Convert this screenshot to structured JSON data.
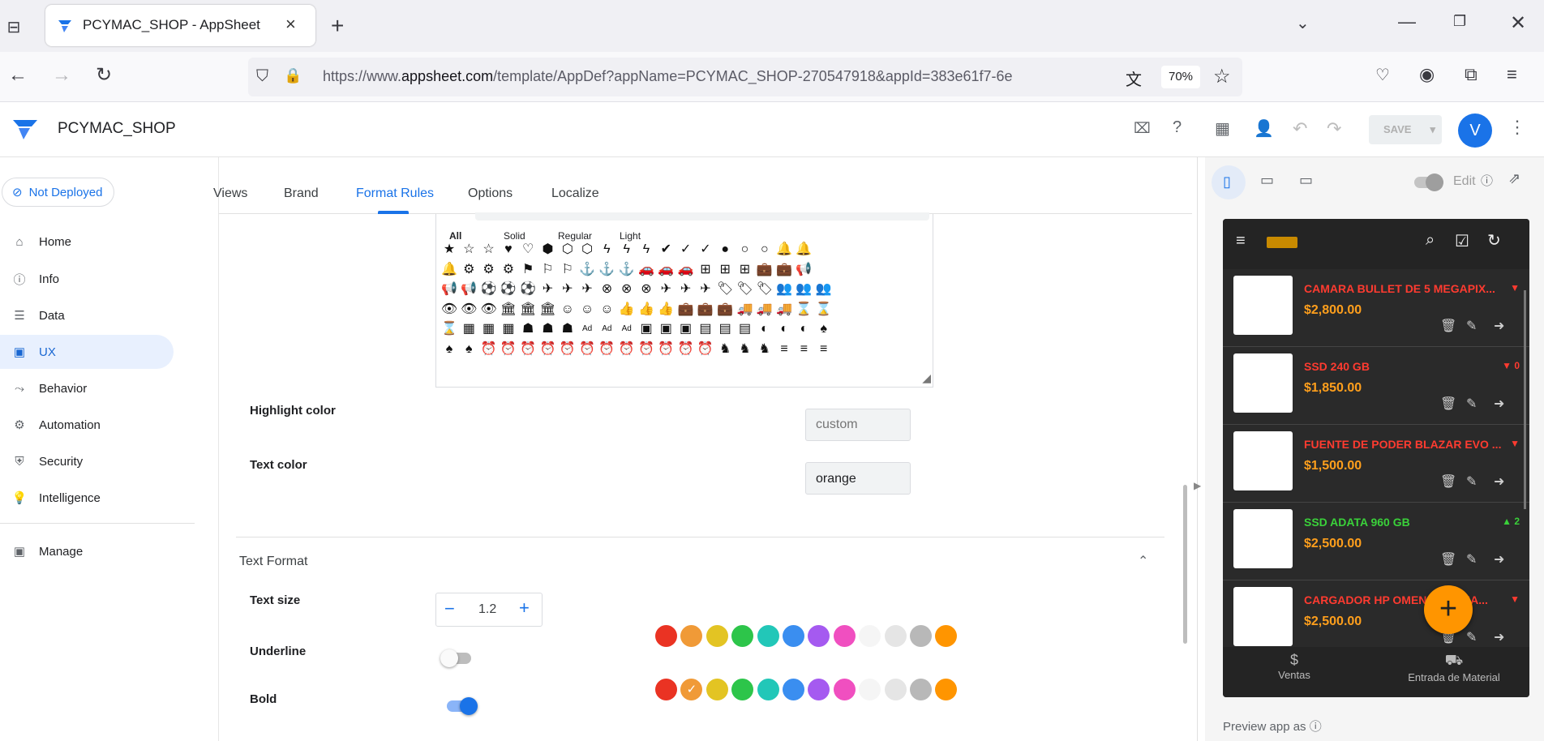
{
  "browser": {
    "tab_title": "PCYMAC_SHOP - AppSheet",
    "url_prefix": "https://www.",
    "url_domain": "appsheet.com",
    "url_rest": "/template/AppDef?appName=PCYMAC_SHOP-270547918&appId=383e61f7-6e",
    "zoom": "70%"
  },
  "app": {
    "name": "PCYMAC_SHOP",
    "save_label": "SAVE",
    "avatar_letter": "V",
    "deploy_status": "Not Deployed"
  },
  "sidebar": {
    "items": [
      {
        "label": "Home",
        "icon": "home-icon"
      },
      {
        "label": "Info",
        "icon": "info-icon"
      },
      {
        "label": "Data",
        "icon": "data-icon"
      },
      {
        "label": "UX",
        "icon": "ux-icon"
      },
      {
        "label": "Behavior",
        "icon": "behavior-icon"
      },
      {
        "label": "Automation",
        "icon": "automation-icon"
      },
      {
        "label": "Security",
        "icon": "security-icon"
      },
      {
        "label": "Intelligence",
        "icon": "intelligence-icon"
      },
      {
        "label": "Manage",
        "icon": "manage-icon"
      }
    ]
  },
  "tabs": [
    "Views",
    "Brand",
    "Format Rules",
    "Options",
    "Localize"
  ],
  "icon_picker": {
    "filters": [
      "All",
      "Solid",
      "Regular",
      "Light"
    ],
    "rows": [
      [
        "★",
        "☆",
        "☆",
        "♥",
        "♡",
        "⬢",
        "⬡",
        "⬡",
        "ϟ",
        "ϟ",
        "ϟ",
        "✔",
        "✓",
        "✓",
        "●",
        "○",
        "○",
        "🔔",
        "🔔"
      ],
      [
        "🔔",
        "⚙",
        "⚙",
        "⚙",
        "⚑",
        "⚐",
        "⚐",
        "⚓",
        "⚓",
        "⚓",
        "🚗",
        "🚗",
        "🚗",
        "⊞",
        "⊞",
        "⊞",
        "💼",
        "💼",
        "📢"
      ],
      [
        "📢",
        "📢",
        "⚽",
        "⚽",
        "⚽",
        "✈",
        "✈",
        "✈",
        "⊗",
        "⊗",
        "⊗",
        "✈",
        "✈",
        "✈",
        "🏷",
        "🏷",
        "🏷",
        "👥",
        "👥",
        "👥"
      ],
      [
        "👁",
        "👁",
        "👁",
        "🏛",
        "🏛",
        "🏛",
        "☺",
        "☺",
        "☺",
        "👍",
        "👍",
        "👍",
        "💼",
        "💼",
        "💼",
        "🚚",
        "🚚",
        "🚚",
        "⌛",
        "⌛"
      ],
      [
        "⌛",
        "▦",
        "▦",
        "▦",
        "☗",
        "☗",
        "☗",
        "Ad",
        "Ad",
        "Ad",
        "▣",
        "▣",
        "▣",
        "▤",
        "▤",
        "▤",
        "◐",
        "◐",
        "◐",
        "♠"
      ],
      [
        "♠",
        "♠",
        "⏰",
        "⏰",
        "⏰",
        "⏰",
        "⏰",
        "⏰",
        "⏰",
        "⏰",
        "⏰",
        "⏰",
        "⏰",
        "⏰",
        "♞",
        "♞",
        "♞",
        "≡",
        "≡",
        "≡"
      ]
    ]
  },
  "highlight_color": {
    "label": "Highlight color",
    "value": "",
    "placeholder": "custom"
  },
  "text_color": {
    "label": "Text color",
    "value": "orange",
    "selected": "#ff9f1c"
  },
  "swatches": [
    "#ea3323",
    "#f09a37",
    "#e3c423",
    "#2dc54a",
    "#22c7b8",
    "#3a8ef0",
    "#a55af0",
    "#f04fc0",
    "#f5f5f5",
    "#e5e5e5",
    "#b8b8b8",
    "#ff9500"
  ],
  "text_format": {
    "section": "Text Format",
    "size_label": "Text size",
    "size_value": "1.2",
    "underline_label": "Underline",
    "bold_label": "Bold"
  },
  "preview": {
    "edit_label": "Edit",
    "footer_label": "Preview app as",
    "products": [
      {
        "title": "CAMARA BULLET DE 5 MEGAPIX...",
        "price": "$2,800.00",
        "badge": "",
        "trend": "down",
        "title_color": "#ff3b30"
      },
      {
        "title": "SSD 240 GB",
        "price": "$1,850.00",
        "badge": "0",
        "trend": "down",
        "title_color": "#ff3b30"
      },
      {
        "title": "FUENTE DE PODER BLAZAR EVO ...",
        "price": "$1,500.00",
        "badge": "",
        "trend": "down",
        "title_color": "#ff3b30"
      },
      {
        "title": "SSD ADATA 960 GB",
        "price": "$2,500.00",
        "badge": "2",
        "trend": "up",
        "title_color": "#3ad13a"
      },
      {
        "title": "CARGADOR HP OMEN ORIGINA...",
        "price": "$2,500.00",
        "badge": "",
        "trend": "down",
        "title_color": "#ff3b30"
      }
    ],
    "bottom_nav": [
      "Ventas",
      "Entrada de Material"
    ]
  }
}
